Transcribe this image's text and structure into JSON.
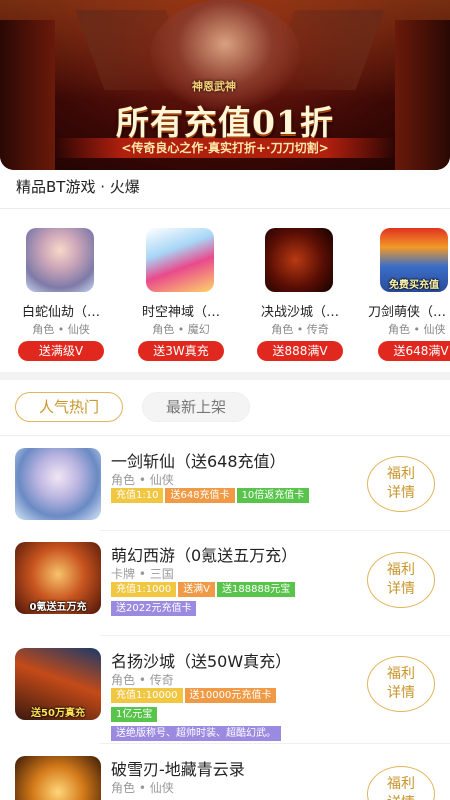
{
  "banner": {
    "logo": "神恩武神",
    "headline": "所有充值01折",
    "subline": "<传奇良心之作·真实打折+·刀刀切割>"
  },
  "section": {
    "title": "精品BT游戏 · 火爆"
  },
  "featured": [
    {
      "name": "白蛇仙劫（…",
      "tags": "角色 • 仙侠",
      "badge": "送满级V",
      "icon": "game-icon-baishe",
      "icon_text": ""
    },
    {
      "name": "时空神域（…",
      "tags": "角色 • 魔幻",
      "badge": "送3W真充",
      "icon": "game-icon-shikong",
      "icon_text": ""
    },
    {
      "name": "决战沙城（…",
      "tags": "角色 • 传奇",
      "badge": "送888满V",
      "icon": "game-icon-juezhan",
      "icon_text": ""
    },
    {
      "name": "刀剑萌侠（…",
      "tags": "角色 • 仙侠",
      "badge": "送648满V",
      "icon": "game-icon-daojian",
      "icon_text": "免费买充值"
    }
  ],
  "tabs": {
    "hot": "人气热门",
    "new": "最新上架"
  },
  "games": [
    {
      "name": "一剑斩仙（送648充值）",
      "tags": "角色 • 仙侠",
      "chips": [
        {
          "text": "充值1:10",
          "color": "yellow"
        },
        {
          "text": "送648充值卡",
          "color": "orange"
        },
        {
          "text": "10倍返充值卡",
          "color": "green"
        }
      ],
      "cta_line1": "福利",
      "cta_line2": "详情",
      "icon_text": ""
    },
    {
      "name": "萌幻西游（0氪送五万充）",
      "tags": "卡牌 • 三国",
      "chips": [
        {
          "text": "充值1:1000",
          "color": "yellow"
        },
        {
          "text": "送满V",
          "color": "orange"
        },
        {
          "text": "送188888元宝",
          "color": "green"
        },
        {
          "text": "送2022元充值卡",
          "color": "purple"
        }
      ],
      "cta_line1": "福利",
      "cta_line2": "详情",
      "icon_text": "0氪送五万充"
    },
    {
      "name": "名扬沙城（送50W真充）",
      "tags": "角色 • 传奇",
      "chips": [
        {
          "text": "充值1:10000",
          "color": "yellow"
        },
        {
          "text": "送10000元充值卡",
          "color": "orange"
        },
        {
          "text": "1亿元宝",
          "color": "green"
        },
        {
          "text": "送绝版称号、超帅时装、超酷幻武。",
          "color": "purple"
        }
      ],
      "cta_line1": "福利",
      "cta_line2": "详情",
      "icon_text": "送50万真充"
    },
    {
      "name": "破雪刃-地藏青云录",
      "tags": "角色 • 仙侠",
      "chips": [],
      "cta_line1": "福利",
      "cta_line2": "详情",
      "icon_text": ""
    }
  ]
}
